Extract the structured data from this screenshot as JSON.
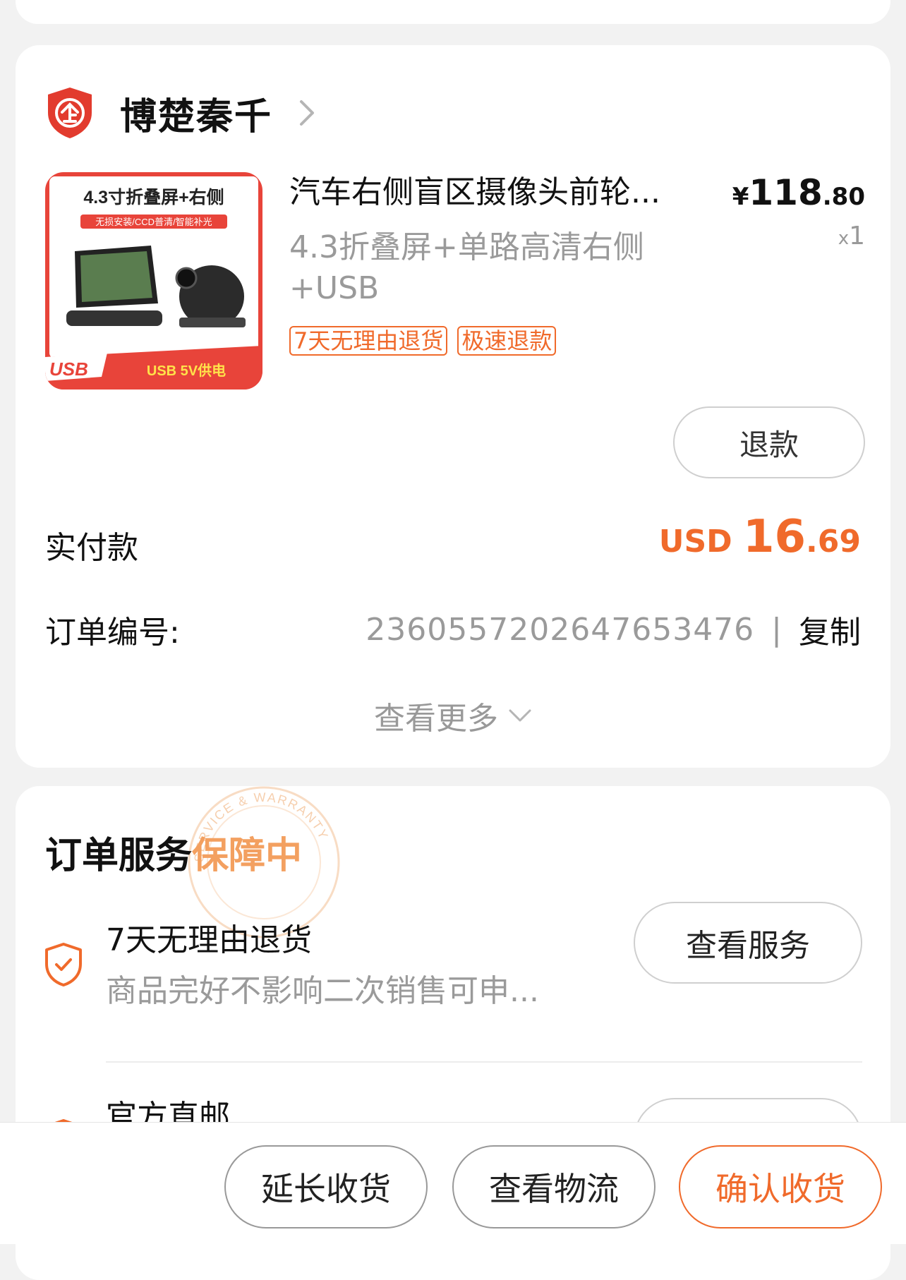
{
  "shop": {
    "name": "博楚秦千"
  },
  "product": {
    "title": "汽车右侧盲区摄像头前轮...",
    "spec": "4.3折叠屏+单路高清右侧+USB",
    "image_text": {
      "headline": "4.3寸折叠屏+右侧",
      "sub": "无损安装/CCD普清/智能补光",
      "usb_label": "USB",
      "power": "USB 5V供电"
    },
    "tags": [
      "7天无理由退货",
      "极速退款"
    ],
    "price": {
      "currency": "¥",
      "int": "118",
      "dec": ".80"
    },
    "quantity": {
      "x": "x",
      "count": "1"
    },
    "refund_label": "退款"
  },
  "payment": {
    "label": "实付款",
    "currency": "USD ",
    "int": "16",
    "dec": ".69"
  },
  "order": {
    "label": "订单编号:",
    "number": "2360557202647653476",
    "separator": "|",
    "copy_label": "复制"
  },
  "more_label": "查看更多",
  "service": {
    "title_prefix": "订单服务",
    "title_highlight": "保障中",
    "stamp_text": "SERVICE & WARRANTY",
    "items": [
      {
        "title": "7天无理由退货",
        "desc": "商品完好不影响二次销售可申...",
        "button": "查看服务"
      },
      {
        "title": "官方直邮"
      }
    ]
  },
  "bottom_bar": {
    "buttons": [
      "延长收货",
      "查看物流",
      "确认收货"
    ]
  },
  "colors": {
    "accent": "#f06a2b",
    "muted": "#9a9a9a",
    "stamp": "#f3a060"
  }
}
